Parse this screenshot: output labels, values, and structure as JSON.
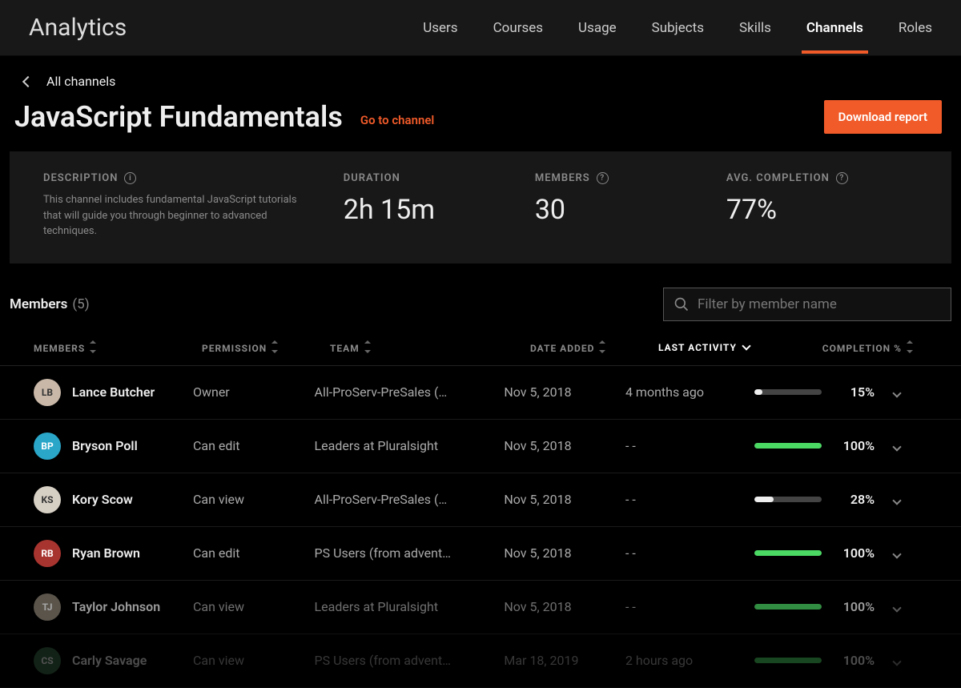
{
  "header": {
    "title": "Analytics",
    "tabs": [
      "Users",
      "Courses",
      "Usage",
      "Subjects",
      "Skills",
      "Channels",
      "Roles"
    ],
    "active_tab": "Channels"
  },
  "breadcrumb": {
    "back_label": "All channels"
  },
  "channel": {
    "title": "JavaScript Fundamentals",
    "go_link": "Go to channel",
    "download_button": "Download report"
  },
  "stats": {
    "description_label": "DESCRIPTION",
    "description_text": "This channel includes fundamental JavaScript tutorials that will guide you through beginner to advanced techniques.",
    "duration_label": "DURATION",
    "duration_value": "2h 15m",
    "members_label": "MEMBERS",
    "members_value": "30",
    "avg_completion_label": "AVG. COMPLETION",
    "avg_completion_value": "77%"
  },
  "members_section": {
    "label": "Members",
    "count": "(5)",
    "filter_placeholder": "Filter by member name"
  },
  "columns": {
    "members": "MEMBERS",
    "permission": "PERMISSION",
    "team": "TEAM",
    "date": "DATE ADDED",
    "activity": "LAST ACTIVITY",
    "completion": "COMPLETION %"
  },
  "rows": [
    {
      "name": "Lance Butcher",
      "initials": "LB",
      "avatar_bg": "#c9b8a8",
      "avatar_fg": "#333",
      "permission": "Owner",
      "team": "All-ProServ-PreSales (…",
      "date": "Nov 5, 2018",
      "activity": "4 months ago",
      "completion": 15,
      "bar_style": "dot"
    },
    {
      "name": "Bryson Poll",
      "initials": "BP",
      "avatar_bg": "#2aa6c8",
      "avatar_fg": "#fff",
      "permission": "Can edit",
      "team": "Leaders at Pluralsight",
      "date": "Nov 5, 2018",
      "activity": "- -",
      "completion": 100,
      "bar_style": "fill"
    },
    {
      "name": "Kory Scow",
      "initials": "KS",
      "avatar_bg": "#d6cfc4",
      "avatar_fg": "#333",
      "permission": "Can view",
      "team": "All-ProServ-PreSales (…",
      "date": "Nov 5, 2018",
      "activity": "- -",
      "completion": 28,
      "bar_style": "white"
    },
    {
      "name": "Ryan Brown",
      "initials": "RB",
      "avatar_bg": "#a8342f",
      "avatar_fg": "#fff",
      "permission": "Can edit",
      "team": "PS Users (from advent…",
      "date": "Nov 5, 2018",
      "activity": "- -",
      "completion": 100,
      "bar_style": "fill"
    },
    {
      "name": "Taylor Johnson",
      "initials": "TJ",
      "avatar_bg": "#8a8274",
      "avatar_fg": "#fff",
      "permission": "Can view",
      "team": "Leaders at Pluralsight",
      "date": "Nov 5, 2018",
      "activity": "- -",
      "completion": 100,
      "bar_style": "fill"
    },
    {
      "name": "Carly Savage",
      "initials": "CS",
      "avatar_bg": "#3a6a4a",
      "avatar_fg": "#fff",
      "permission": "Can view",
      "team": "PS Users (from advent…",
      "date": "Mar 18, 2019",
      "activity": "2 hours ago",
      "completion": 100,
      "bar_style": "fill"
    }
  ]
}
